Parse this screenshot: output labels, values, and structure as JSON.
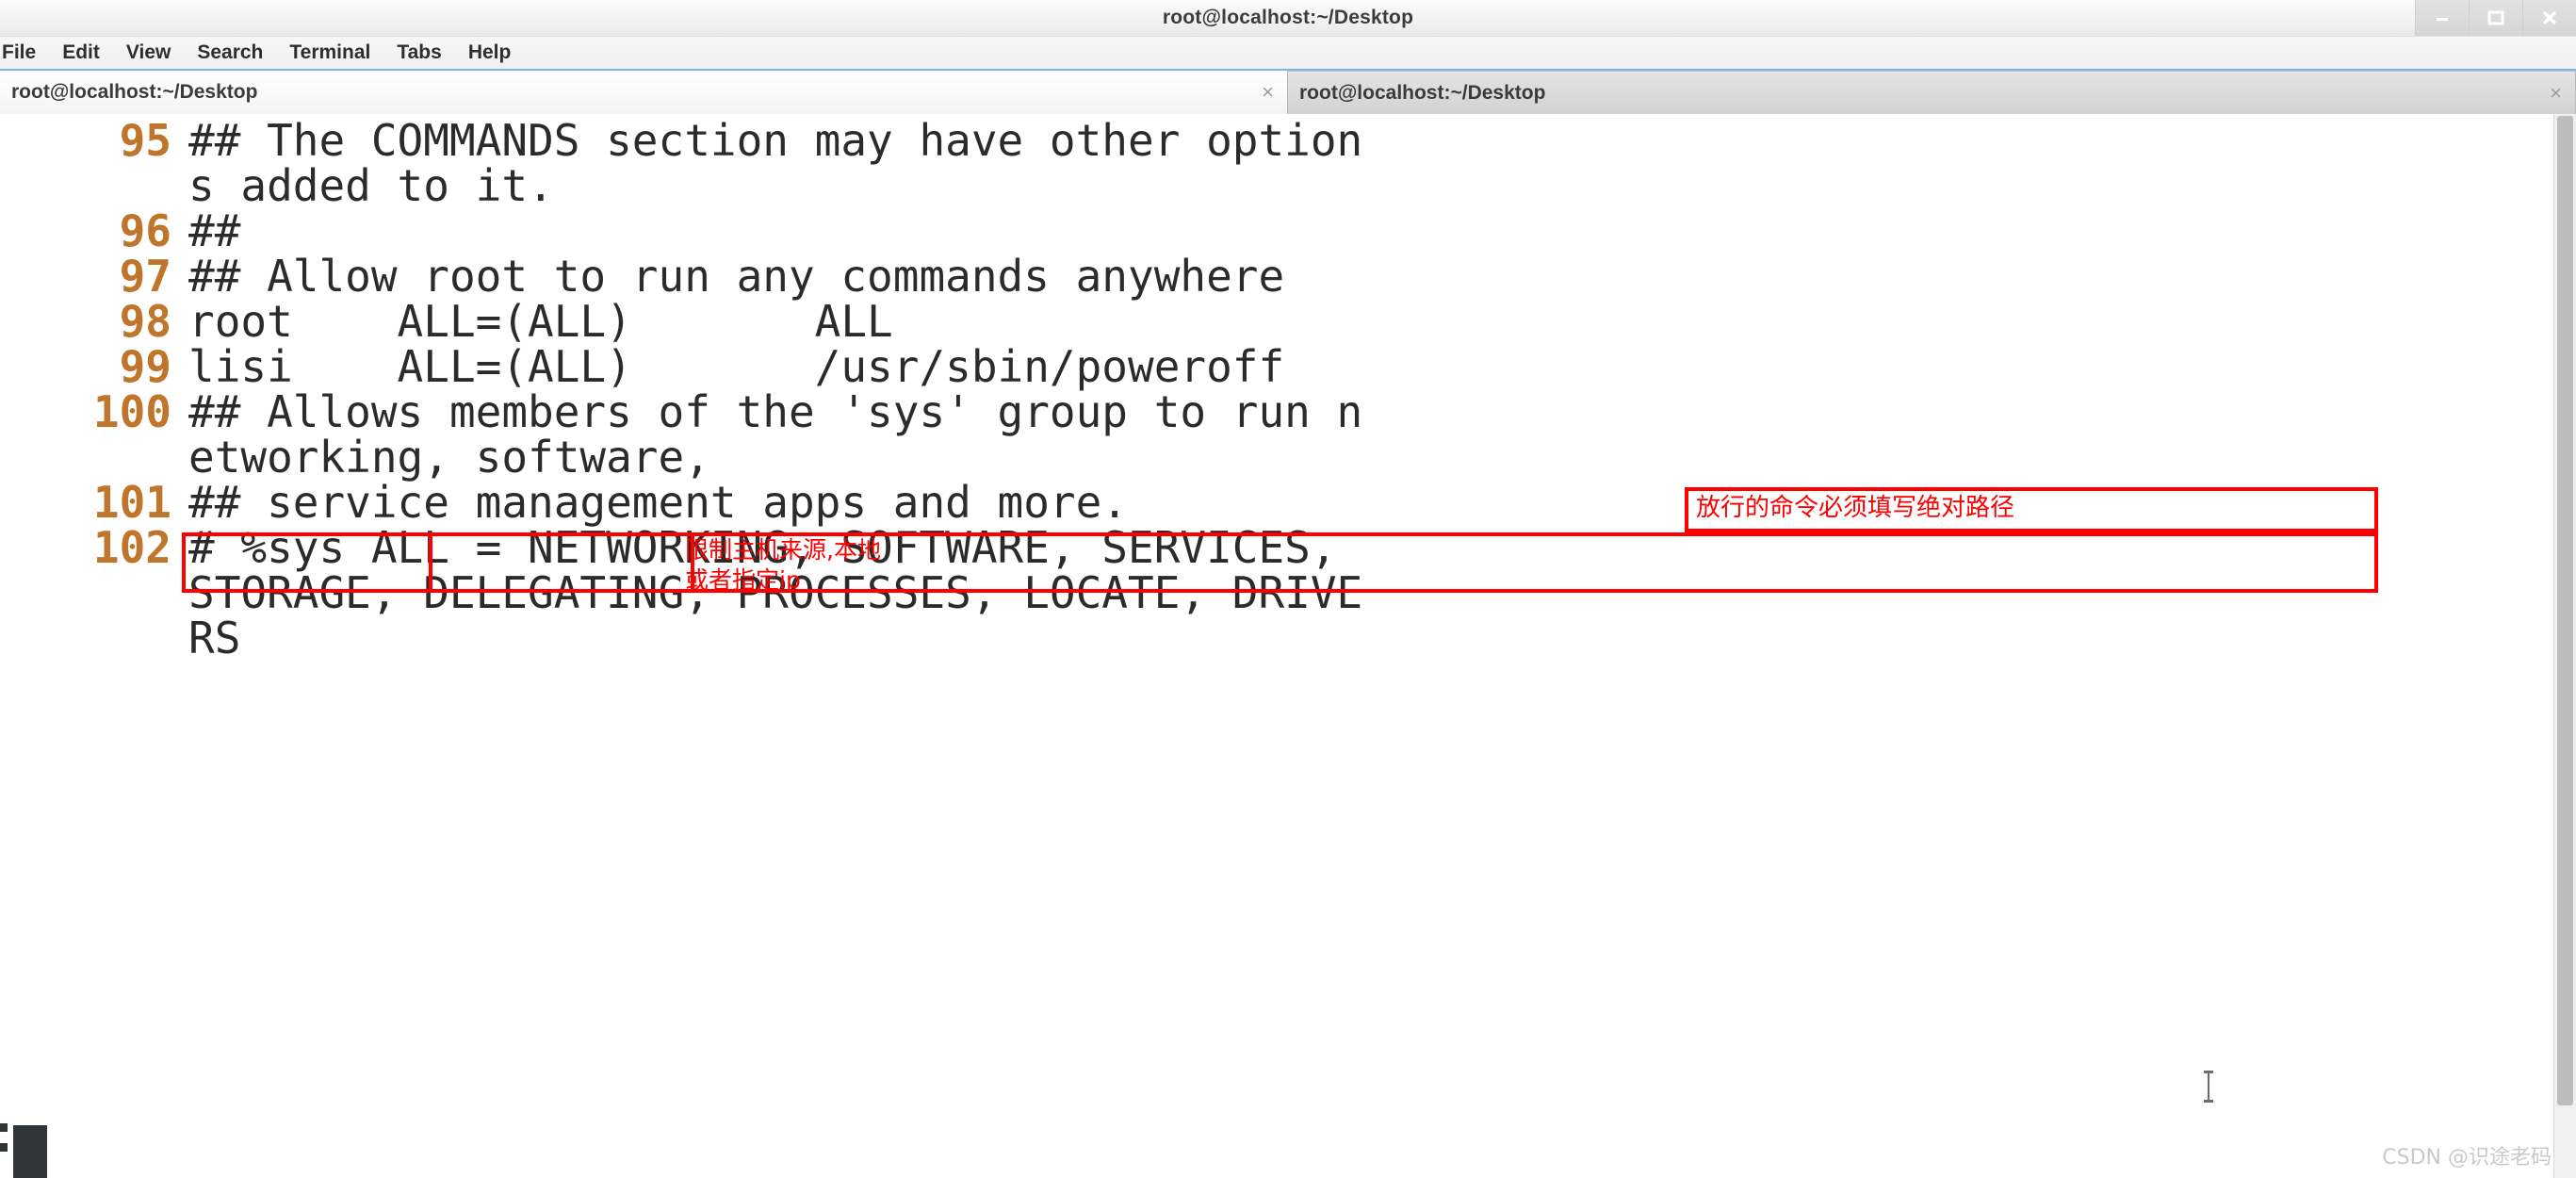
{
  "window": {
    "title": "root@localhost:~/Desktop",
    "controls": [
      {
        "name": "minimize",
        "glyph": "minimize-icon"
      },
      {
        "name": "maximize",
        "glyph": "maximize-icon"
      },
      {
        "name": "close",
        "glyph": "close-icon"
      }
    ]
  },
  "menubar": {
    "items": [
      {
        "label": "File"
      },
      {
        "label": "Edit"
      },
      {
        "label": "View"
      },
      {
        "label": "Search"
      },
      {
        "label": "Terminal"
      },
      {
        "label": "Tabs"
      },
      {
        "label": "Help"
      }
    ]
  },
  "tabs": [
    {
      "label": "root@localhost:~/Desktop",
      "active": true,
      "close_glyph": "×"
    },
    {
      "label": "root@localhost:~/Desktop",
      "active": false,
      "close_glyph": "×"
    }
  ],
  "terminal": {
    "lines": [
      {
        "no": "95",
        "text": "## The COMMANDS section may have other option"
      },
      {
        "no": "",
        "text": "s added to it."
      },
      {
        "no": "96",
        "text": "##"
      },
      {
        "no": "97",
        "text": "## Allow root to run any commands anywhere"
      },
      {
        "no": "98",
        "text": "root    ALL=(ALL)       ALL"
      },
      {
        "no": "99",
        "text": "lisi    ALL=(ALL)       /usr/sbin/poweroff"
      },
      {
        "no": "100",
        "text": "## Allows members of the 'sys' group to run n"
      },
      {
        "no": "",
        "text": "etworking, software,"
      },
      {
        "no": "101",
        "text": "## service management apps and more."
      },
      {
        "no": "102",
        "text": "# %sys ALL = NETWORKING, SOFTWARE, SERVICES,"
      },
      {
        "no": "",
        "text": "STORAGE, DELEGATING, PROCESSES, LOCATE, DRIVE"
      },
      {
        "no": "",
        "text": "RS"
      }
    ]
  },
  "annotations": {
    "accent_color": "#ff0000",
    "absolute_path_note": "放行的命令必须填写绝对路径",
    "host_source_note": "限制主机来源,本地\n或者指定ip"
  },
  "watermark": {
    "text": "CSDN @识途老码"
  }
}
